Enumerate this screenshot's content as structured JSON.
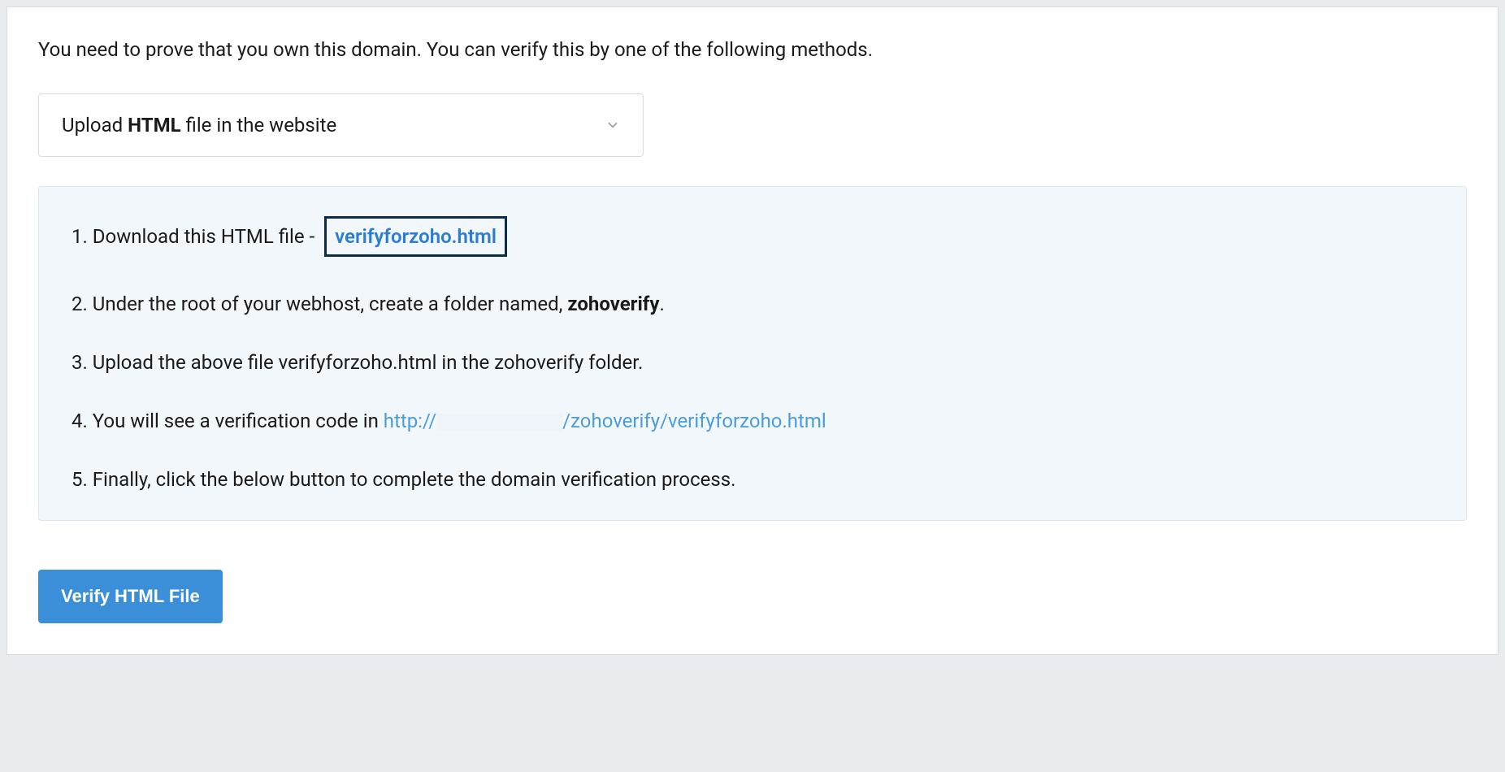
{
  "intro": "You need to prove that you own this domain. You can verify this by one of the following methods.",
  "dropdown": {
    "prefix": "Upload ",
    "bold": "HTML",
    "suffix": " file in the website"
  },
  "steps": {
    "s1_prefix": "Download this HTML file - ",
    "s1_file": "verifyforzoho.html",
    "s2_prefix": "Under the root of your webhost, create a folder named, ",
    "s2_bold": "zohoverify",
    "s2_suffix": ".",
    "s3": "Upload the above file verifyforzoho.html in the zohoverify folder.",
    "s4_prefix": "You will see a verification code in ",
    "s4_url_pre": "http://",
    "s4_url_post": "/zohoverify/verifyforzoho.html",
    "s5": "Finally, click the below button to complete the domain verification process."
  },
  "button": {
    "verify": "Verify HTML File"
  }
}
